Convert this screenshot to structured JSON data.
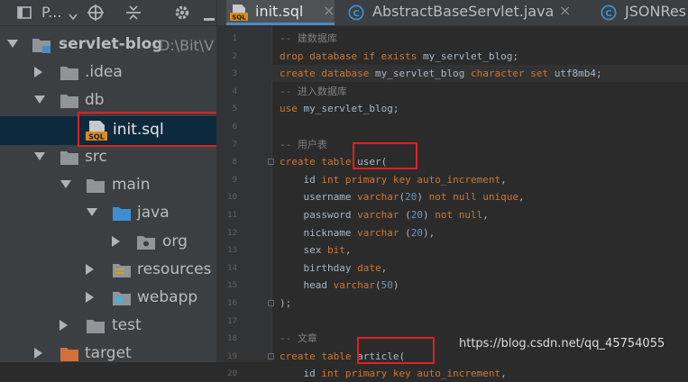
{
  "project_panel": {
    "title": "P...",
    "tree": [
      {
        "label": "servlet-blog",
        "path": "D:\\Bit\\V",
        "icon": "module-folder-icon"
      },
      {
        "label": ".idea",
        "icon": "folder-icon"
      },
      {
        "label": "db",
        "icon": "folder-icon"
      },
      {
        "label": "init.sql",
        "icon": "sql-file-icon"
      },
      {
        "label": "src",
        "icon": "folder-icon"
      },
      {
        "label": "main",
        "icon": "folder-icon"
      },
      {
        "label": "java",
        "icon": "source-folder-icon"
      },
      {
        "label": "org",
        "icon": "package-icon"
      },
      {
        "label": "resources",
        "icon": "resources-folder-icon"
      },
      {
        "label": "webapp",
        "icon": "web-folder-icon"
      },
      {
        "label": "test",
        "icon": "folder-icon"
      },
      {
        "label": "target",
        "icon": "excluded-folder-icon"
      }
    ]
  },
  "tabs": [
    {
      "label": "init.sql",
      "icon": "sql-file-icon",
      "close": "×",
      "active": true
    },
    {
      "label": "AbstractBaseServlet.java",
      "icon": "class-icon",
      "close": "×",
      "active": false
    },
    {
      "label": "JSONRes",
      "icon": "class-icon",
      "active": false
    }
  ],
  "editor": {
    "line_numbers": [
      "1",
      "2",
      "3",
      "4",
      "5",
      "6",
      "7",
      "8",
      "9",
      "10",
      "11",
      "12",
      "13",
      "14",
      "15",
      "16",
      "17",
      "18",
      "19",
      "20"
    ],
    "lines": [
      {
        "text": "-- 建数据库"
      },
      {
        "text": "drop database if exists my_servlet_blog;"
      },
      {
        "text": "create database my_servlet_blog character set utf8mb4;"
      },
      {
        "text": "-- 进入数据库"
      },
      {
        "text": "use my_servlet_blog;"
      },
      {
        "text": ""
      },
      {
        "text": "-- 用户表"
      },
      {
        "text": "create table user("
      },
      {
        "text": "    id int primary key auto_increment,"
      },
      {
        "text": "    username varchar(20) not null unique,"
      },
      {
        "text": "    password varchar (20) not null,"
      },
      {
        "text": "    nickname varchar (20),"
      },
      {
        "text": "    sex bit,"
      },
      {
        "text": "    birthday date,"
      },
      {
        "text": "    head varchar(50)"
      },
      {
        "text": ");"
      },
      {
        "text": ""
      },
      {
        "text": "-- 文章"
      },
      {
        "text": "create table article("
      },
      {
        "text": "    id int primary key auto_increment,"
      }
    ]
  },
  "watermark": "https://blog.csdn.net/qq_45754055",
  "colors": {
    "keyword": "#cc7832",
    "comment": "#808080",
    "number": "#6897bb",
    "text": "#a9b7c6",
    "annotation_box": "#e02020",
    "selection": "#0d293e"
  }
}
